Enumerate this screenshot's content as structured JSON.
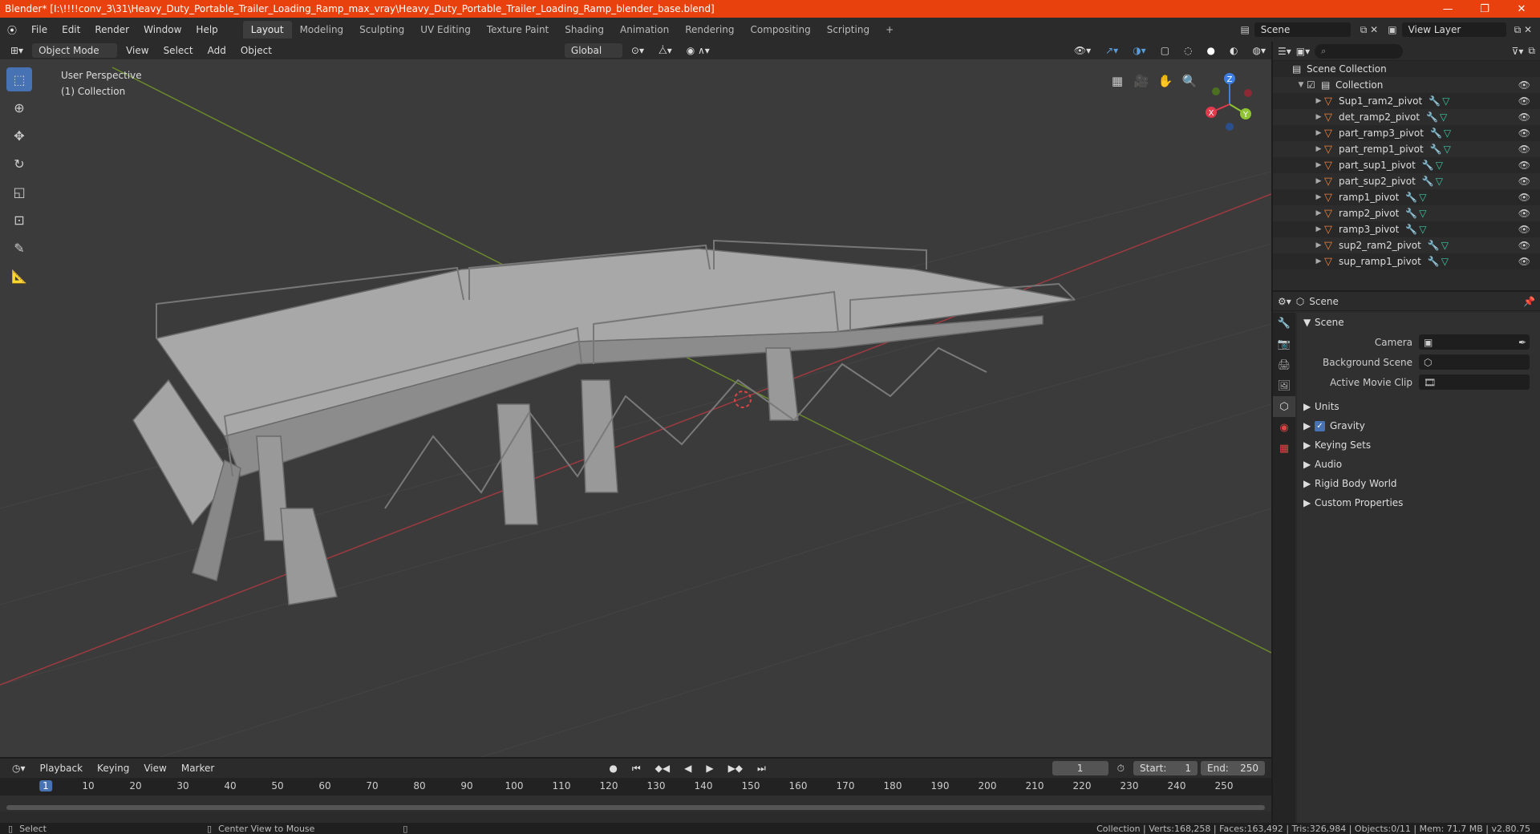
{
  "window": {
    "title": "Blender* [I:\\!!!!conv_3\\31\\Heavy_Duty_Portable_Trailer_Loading_Ramp_max_vray\\Heavy_Duty_Portable_Trailer_Loading_Ramp_blender_base.blend]",
    "minimize": "—",
    "restore": "❐",
    "close": "✕"
  },
  "menu": {
    "items": [
      "File",
      "Edit",
      "Render",
      "Window",
      "Help"
    ]
  },
  "workspaces": [
    "Layout",
    "Modeling",
    "Sculpting",
    "UV Editing",
    "Texture Paint",
    "Shading",
    "Animation",
    "Rendering",
    "Compositing",
    "Scripting"
  ],
  "add_workspace": "+",
  "top_right": {
    "scene": "Scene",
    "view_layer": "View Layer"
  },
  "viewport_header": {
    "mode": "Object Mode",
    "view": "View",
    "select": "Select",
    "add": "Add",
    "object": "Object",
    "transform": "Global"
  },
  "viewport": {
    "perspective": "User Perspective",
    "collection": "(1) Collection"
  },
  "gizmo": {
    "x": "X",
    "y": "Y",
    "z": "Z"
  },
  "outliner": {
    "search_placeholder": "",
    "root": "Scene Collection",
    "collection": "Collection",
    "objects": [
      "Sup1_ram2_pivot",
      "det_ramp2_pivot",
      "part_ramp3_pivot",
      "part_remp1_pivot",
      "part_sup1_pivot",
      "part_sup2_pivot",
      "ramp1_pivot",
      "ramp2_pivot",
      "ramp3_pivot",
      "sup2_ram2_pivot",
      "sup_ramp1_pivot"
    ]
  },
  "properties": {
    "context": "Scene",
    "section": "Scene",
    "camera_label": "Camera",
    "background_scene_label": "Background Scene",
    "active_movie_clip_label": "Active Movie Clip",
    "subsections": [
      "Units",
      "Gravity",
      "Keying Sets",
      "Audio",
      "Rigid Body World",
      "Custom Properties"
    ]
  },
  "timeline": {
    "playback": "Playback",
    "keying": "Keying",
    "view": "View",
    "marker": "Marker",
    "current_frame": "1",
    "start_label": "Start:",
    "start": "1",
    "end_label": "End:",
    "end": "250",
    "ticks": [
      "1",
      "10",
      "20",
      "30",
      "40",
      "50",
      "60",
      "70",
      "80",
      "90",
      "100",
      "110",
      "120",
      "130",
      "140",
      "150",
      "160",
      "170",
      "180",
      "190",
      "200",
      "210",
      "220",
      "230",
      "240",
      "250"
    ]
  },
  "statusbar": {
    "select": "Select",
    "center": "Center View to Mouse",
    "stats": "Collection | Verts:168,258 | Faces:163,492 | Tris:326,984 | Objects:0/11 | Mem: 71.7 MB | v2.80.75"
  },
  "colors": {
    "accent": "#4772b3",
    "titlebar": "#e8410e",
    "x_axis": "#e03a4c",
    "y_axis": "#8fc433",
    "z_axis": "#3d7fe0"
  }
}
